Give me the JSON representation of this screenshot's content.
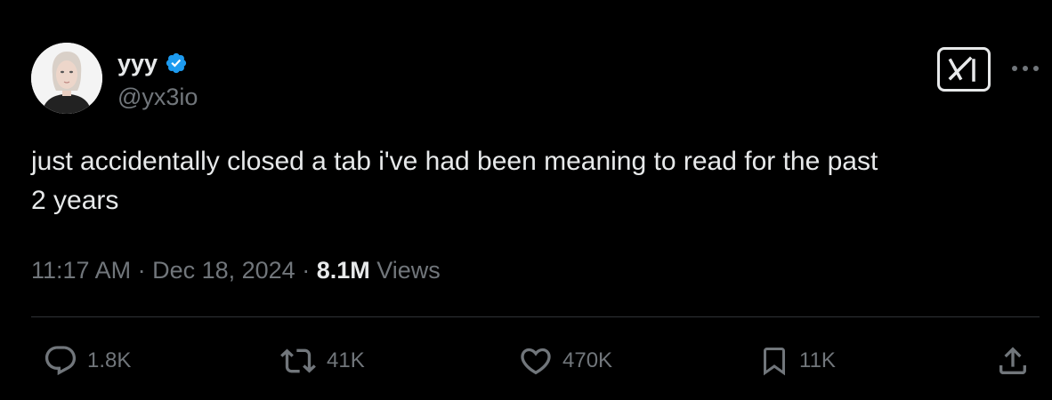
{
  "author": {
    "display_name": "yyy",
    "handle": "@yx3io",
    "verified_icon": "verified-badge-icon",
    "verified_color": "#1d9bf0"
  },
  "tweet": {
    "text": "just accidentally closed a tab i've had been meaning to read for the past\n2 years"
  },
  "meta": {
    "time": "11:17 AM",
    "separator": " · ",
    "date": "Dec 18, 2024",
    "views_count": "8.1M",
    "views_label": "Views"
  },
  "actions": {
    "replies": "1.8K",
    "reposts": "41K",
    "likes": "470K",
    "bookmarks": "11K"
  },
  "icons": {
    "grok": "grok-icon",
    "more": "more-dots-icon",
    "reply": "reply-bubble-icon",
    "repost": "repost-icon",
    "like": "heart-icon",
    "bookmark": "bookmark-icon",
    "share": "share-icon"
  },
  "colors": {
    "background": "#000000",
    "primary_text": "#e7e9ea",
    "secondary_text": "#71767b",
    "divider": "#2f3336",
    "accent": "#1d9bf0"
  }
}
